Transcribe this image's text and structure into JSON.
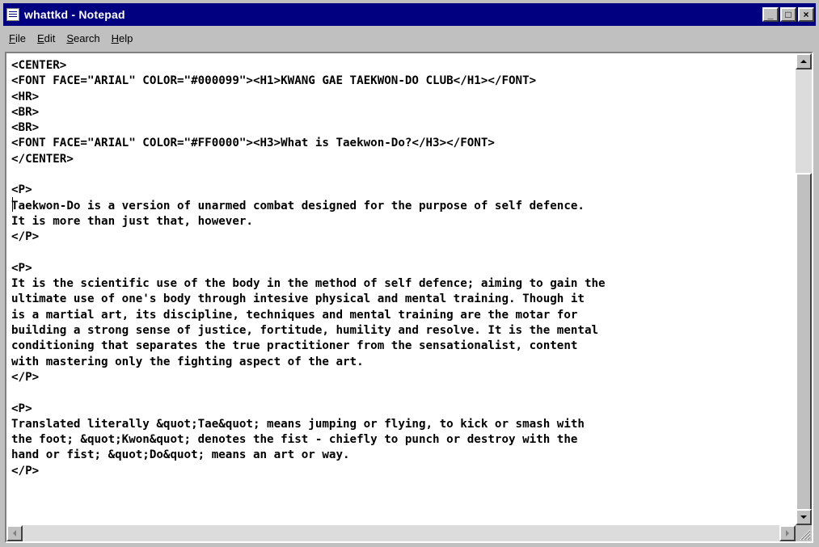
{
  "window": {
    "title": "whattkd - Notepad",
    "minimize_glyph": "_",
    "maximize_glyph": "□",
    "close_glyph": "×"
  },
  "menu": [
    {
      "accel": "F",
      "rest": "ile"
    },
    {
      "accel": "E",
      "rest": "dit"
    },
    {
      "accel": "S",
      "rest": "earch"
    },
    {
      "accel": "H",
      "rest": "elp"
    }
  ],
  "document": {
    "text": "<CENTER>\n<FONT FACE=\"ARIAL\" COLOR=\"#000099\"><H1>KWANG GAE TAEKWON-DO CLUB</H1></FONT>\n<HR>\n<BR>\n<BR>\n<FONT FACE=\"ARIAL\" COLOR=\"#FF0000\"><H3>What is Taekwon-Do?</H3></FONT>\n</CENTER>\n\n<P>\nTaekwon-Do is a version of unarmed combat designed for the purpose of self defence.\nIt is more than just that, however.\n</P>\n\n<P>\nIt is the scientific use of the body in the method of self defence; aiming to gain the\nultimate use of one's body through intesive physical and mental training. Though it\nis a martial art, its discipline, techniques and mental training are the motar for\nbuilding a strong sense of justice, fortitude, humility and resolve. It is the mental\nconditioning that separates the true practitioner from the sensationalist, content\nwith mastering only the fighting aspect of the art.\n</P>\n\n<P>\nTranslated literally &quot;Tae&quot; means jumping or flying, to kick or smash with\nthe foot; &quot;Kwon&quot; denotes the fist - chiefly to punch or destroy with the\nhand or fist; &quot;Do&quot; means an art or way.\n</P>"
  },
  "icons": {
    "app": "notepad-icon",
    "scroll_up": "arrow-up-icon",
    "scroll_down": "arrow-down-icon",
    "scroll_left": "arrow-left-icon",
    "scroll_right": "arrow-right-icon"
  }
}
